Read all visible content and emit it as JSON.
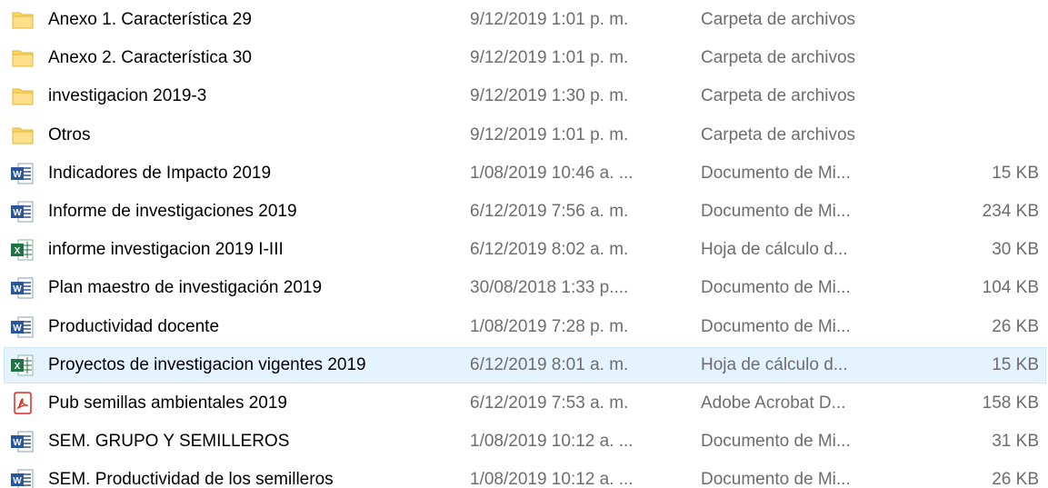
{
  "files": [
    {
      "name": "Anexo 1. Característica 29",
      "date": "9/12/2019 1:01 p. m.",
      "type": "Carpeta de archivos",
      "size": "",
      "icon": "folder-icon"
    },
    {
      "name": "Anexo 2. Característica 30",
      "date": "9/12/2019 1:01 p. m.",
      "type": "Carpeta de archivos",
      "size": "",
      "icon": "folder-icon"
    },
    {
      "name": "investigacion 2019-3",
      "date": "9/12/2019 1:30 p. m.",
      "type": "Carpeta de archivos",
      "size": "",
      "icon": "folder-icon"
    },
    {
      "name": "Otros",
      "date": "9/12/2019 1:01 p. m.",
      "type": "Carpeta de archivos",
      "size": "",
      "icon": "folder-icon"
    },
    {
      "name": "Indicadores de Impacto 2019",
      "date": "1/08/2019 10:46 a. ...",
      "type": "Documento de Mi...",
      "size": "15 KB",
      "icon": "word-document-icon"
    },
    {
      "name": "Informe de investigaciones 2019",
      "date": "6/12/2019 7:56 a. m.",
      "type": "Documento de Mi...",
      "size": "234 KB",
      "icon": "word-document-icon"
    },
    {
      "name": "informe investigacion 2019 I-III",
      "date": "6/12/2019 8:02 a. m.",
      "type": "Hoja de cálculo d...",
      "size": "30 KB",
      "icon": "excel-spreadsheet-icon"
    },
    {
      "name": "Plan maestro de investigación 2019",
      "date": "30/08/2018 1:33 p....",
      "type": "Documento de Mi...",
      "size": "104 KB",
      "icon": "word-document-icon"
    },
    {
      "name": "Productividad docente",
      "date": "1/08/2019 7:28 p. m.",
      "type": "Documento de Mi...",
      "size": "26 KB",
      "icon": "word-document-icon"
    },
    {
      "name": "Proyectos de investigacion vigentes 2019",
      "date": "6/12/2019 8:01 a. m.",
      "type": "Hoja de cálculo d...",
      "size": "15 KB",
      "icon": "excel-spreadsheet-icon",
      "selected": true
    },
    {
      "name": "Pub semillas ambientales 2019",
      "date": "6/12/2019 7:53 a. m.",
      "type": "Adobe Acrobat D...",
      "size": "158 KB",
      "icon": "pdf-document-icon"
    },
    {
      "name": "SEM. GRUPO Y SEMILLEROS",
      "date": "1/08/2019 10:12 a. ...",
      "type": "Documento de Mi...",
      "size": "31 KB",
      "icon": "word-document-icon"
    },
    {
      "name": "SEM. Productividad de los semilleros",
      "date": "1/08/2019 10:12 a. ...",
      "type": "Documento de Mi...",
      "size": "26 KB",
      "icon": "word-document-icon"
    }
  ],
  "colors": {
    "selection_background": "#e5f3ff",
    "selection_border": "#cce8ff",
    "folder_yellow": "#ffd75e",
    "word_blue": "#2b579a",
    "excel_green": "#217346",
    "pdf_red": "#e3261b",
    "secondary_text": "#6d6d6d"
  }
}
